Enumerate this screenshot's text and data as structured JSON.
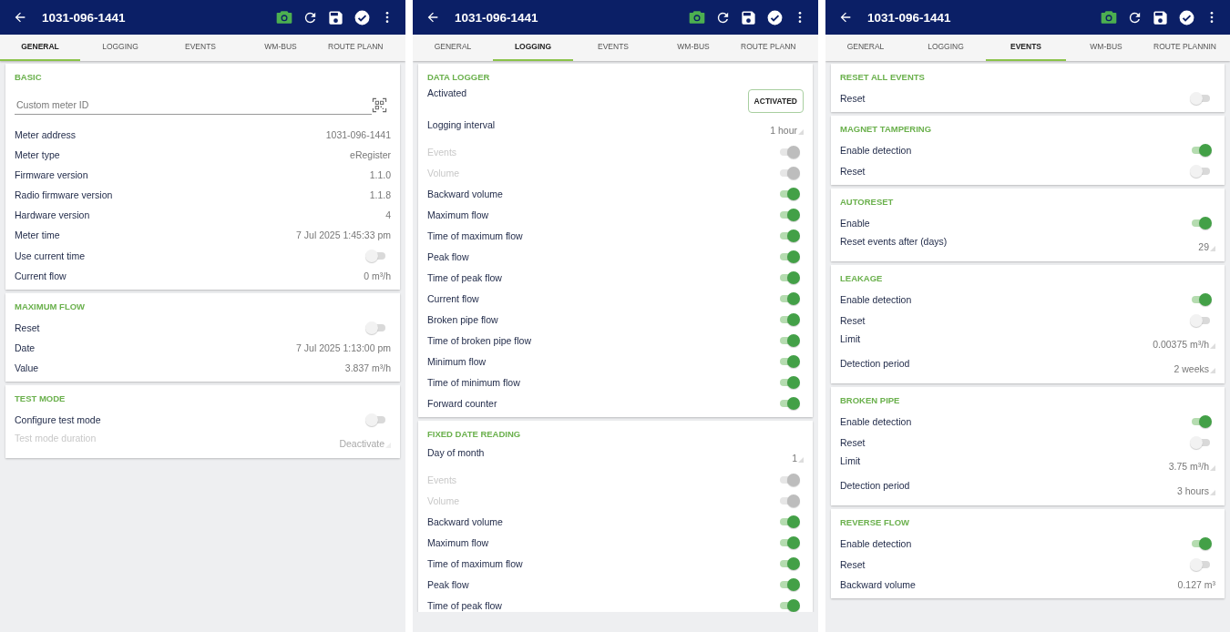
{
  "screens": [
    {
      "title": "1031-096-1441",
      "tabs": [
        {
          "label": "GENERAL",
          "selected": true
        },
        {
          "label": "LOGGING",
          "selected": false
        },
        {
          "label": "EVENTS",
          "selected": false
        },
        {
          "label": "WM-BUS",
          "selected": false
        },
        {
          "label": "ROUTE PLANN",
          "selected": false
        }
      ],
      "sections": [
        {
          "title": "BASIC",
          "rows": [
            {
              "kind": "field",
              "placeholder": "Custom meter ID"
            },
            {
              "kind": "value",
              "label": "Meter address",
              "value": "1031-096-1441"
            },
            {
              "kind": "value",
              "label": "Meter type",
              "value": "eRegister"
            },
            {
              "kind": "value",
              "label": "Firmware version",
              "value": "1.1.0"
            },
            {
              "kind": "value",
              "label": "Radio firmware version",
              "value": "1.1.8"
            },
            {
              "kind": "value",
              "label": "Hardware version",
              "value": "4"
            },
            {
              "kind": "value",
              "label": "Meter time",
              "value": "7 Jul 2025 1:45:33 pm"
            },
            {
              "kind": "toggle",
              "label": "Use current time",
              "checked": false,
              "disabled": false
            },
            {
              "kind": "value",
              "label": "Current flow",
              "value": "0 m³/h"
            }
          ]
        },
        {
          "title": "MAXIMUM FLOW",
          "rows": [
            {
              "kind": "toggle",
              "label": "Reset",
              "checked": false,
              "disabled": false
            },
            {
              "kind": "value",
              "label": "Date",
              "value": "7 Jul 2025 1:13:00 pm"
            },
            {
              "kind": "value",
              "label": "Value",
              "value": "3.837 m³/h"
            }
          ]
        },
        {
          "title": "TEST MODE",
          "rows": [
            {
              "kind": "toggle",
              "label": "Configure test mode",
              "checked": false,
              "disabled": false
            },
            {
              "kind": "select",
              "label": "Test mode duration",
              "value": "Deactivate",
              "disabled": true
            }
          ]
        }
      ]
    },
    {
      "title": "1031-096-1441",
      "tabs": [
        {
          "label": "GENERAL",
          "selected": false
        },
        {
          "label": "LOGGING",
          "selected": true
        },
        {
          "label": "EVENTS",
          "selected": false
        },
        {
          "label": "WM-BUS",
          "selected": false
        },
        {
          "label": "ROUTE PLANN",
          "selected": false
        }
      ],
      "sections": [
        {
          "title": "DATA LOGGER",
          "rows": [
            {
              "kind": "button",
              "label": "Activated",
              "button": "ACTIVATED"
            },
            {
              "kind": "select",
              "label": "Logging interval",
              "value": "1 hour",
              "disabled": false
            },
            {
              "kind": "toggle",
              "label": "Events",
              "checked": true,
              "disabled": true
            },
            {
              "kind": "toggle",
              "label": "Volume",
              "checked": true,
              "disabled": true
            },
            {
              "kind": "toggle",
              "label": "Backward volume",
              "checked": true,
              "disabled": false
            },
            {
              "kind": "toggle",
              "label": "Maximum flow",
              "checked": true,
              "disabled": false
            },
            {
              "kind": "toggle",
              "label": "Time of maximum flow",
              "checked": true,
              "disabled": false
            },
            {
              "kind": "toggle",
              "label": "Peak flow",
              "checked": true,
              "disabled": false
            },
            {
              "kind": "toggle",
              "label": "Time of peak flow",
              "checked": true,
              "disabled": false
            },
            {
              "kind": "toggle",
              "label": "Current flow",
              "checked": true,
              "disabled": false
            },
            {
              "kind": "toggle",
              "label": "Broken pipe flow",
              "checked": true,
              "disabled": false
            },
            {
              "kind": "toggle",
              "label": "Time of broken pipe flow",
              "checked": true,
              "disabled": false
            },
            {
              "kind": "toggle",
              "label": "Minimum flow",
              "checked": true,
              "disabled": false
            },
            {
              "kind": "toggle",
              "label": "Time of minimum flow",
              "checked": true,
              "disabled": false
            },
            {
              "kind": "toggle",
              "label": "Forward counter",
              "checked": true,
              "disabled": false
            }
          ]
        },
        {
          "title": "FIXED DATE READING",
          "rows": [
            {
              "kind": "select",
              "label": "Day of month",
              "value": "1",
              "disabled": false
            },
            {
              "kind": "toggle",
              "label": "Events",
              "checked": true,
              "disabled": true
            },
            {
              "kind": "toggle",
              "label": "Volume",
              "checked": true,
              "disabled": true
            },
            {
              "kind": "toggle",
              "label": "Backward volume",
              "checked": true,
              "disabled": false
            },
            {
              "kind": "toggle",
              "label": "Maximum flow",
              "checked": true,
              "disabled": false
            },
            {
              "kind": "toggle",
              "label": "Time of maximum flow",
              "checked": true,
              "disabled": false
            },
            {
              "kind": "toggle",
              "label": "Peak flow",
              "checked": true,
              "disabled": false
            },
            {
              "kind": "toggle",
              "label": "Time of peak flow",
              "checked": true,
              "disabled": false
            }
          ]
        }
      ]
    },
    {
      "title": "1031-096-1441",
      "tabs": [
        {
          "label": "GENERAL",
          "selected": false
        },
        {
          "label": "LOGGING",
          "selected": false
        },
        {
          "label": "EVENTS",
          "selected": true
        },
        {
          "label": "WM-BUS",
          "selected": false
        },
        {
          "label": "ROUTE PLANNIN",
          "selected": false
        }
      ],
      "sections": [
        {
          "title": "RESET ALL EVENTS",
          "rows": [
            {
              "kind": "toggle",
              "label": "Reset",
              "checked": false,
              "disabled": false
            }
          ]
        },
        {
          "title": "MAGNET TAMPERING",
          "rows": [
            {
              "kind": "toggle",
              "label": "Enable detection",
              "checked": true,
              "disabled": false
            },
            {
              "kind": "toggle",
              "label": "Reset",
              "checked": false,
              "disabled": false
            }
          ]
        },
        {
          "title": "AUTORESET",
          "rows": [
            {
              "kind": "toggle",
              "label": "Enable",
              "checked": true,
              "disabled": false
            },
            {
              "kind": "select",
              "label": "Reset events after (days)",
              "value": "29",
              "disabled": false
            }
          ]
        },
        {
          "title": "LEAKAGE",
          "rows": [
            {
              "kind": "toggle",
              "label": "Enable detection",
              "checked": true,
              "disabled": false
            },
            {
              "kind": "toggle",
              "label": "Reset",
              "checked": false,
              "disabled": false
            },
            {
              "kind": "select",
              "label": "Limit",
              "value": "0.00375 m³/h",
              "disabled": false
            },
            {
              "kind": "select",
              "label": "Detection period",
              "value": "2 weeks",
              "disabled": false
            }
          ]
        },
        {
          "title": "BROKEN PIPE",
          "rows": [
            {
              "kind": "toggle",
              "label": "Enable detection",
              "checked": true,
              "disabled": false
            },
            {
              "kind": "toggle",
              "label": "Reset",
              "checked": false,
              "disabled": false
            },
            {
              "kind": "select",
              "label": "Limit",
              "value": "3.75 m³/h",
              "disabled": false
            },
            {
              "kind": "select",
              "label": "Detection period",
              "value": "3 hours",
              "disabled": false
            }
          ]
        },
        {
          "title": "REVERSE FLOW",
          "rows": [
            {
              "kind": "toggle",
              "label": "Enable detection",
              "checked": true,
              "disabled": false
            },
            {
              "kind": "toggle",
              "label": "Reset",
              "checked": false,
              "disabled": false
            },
            {
              "kind": "value",
              "label": "Backward volume",
              "value": "0.127 m³"
            }
          ]
        }
      ]
    }
  ]
}
